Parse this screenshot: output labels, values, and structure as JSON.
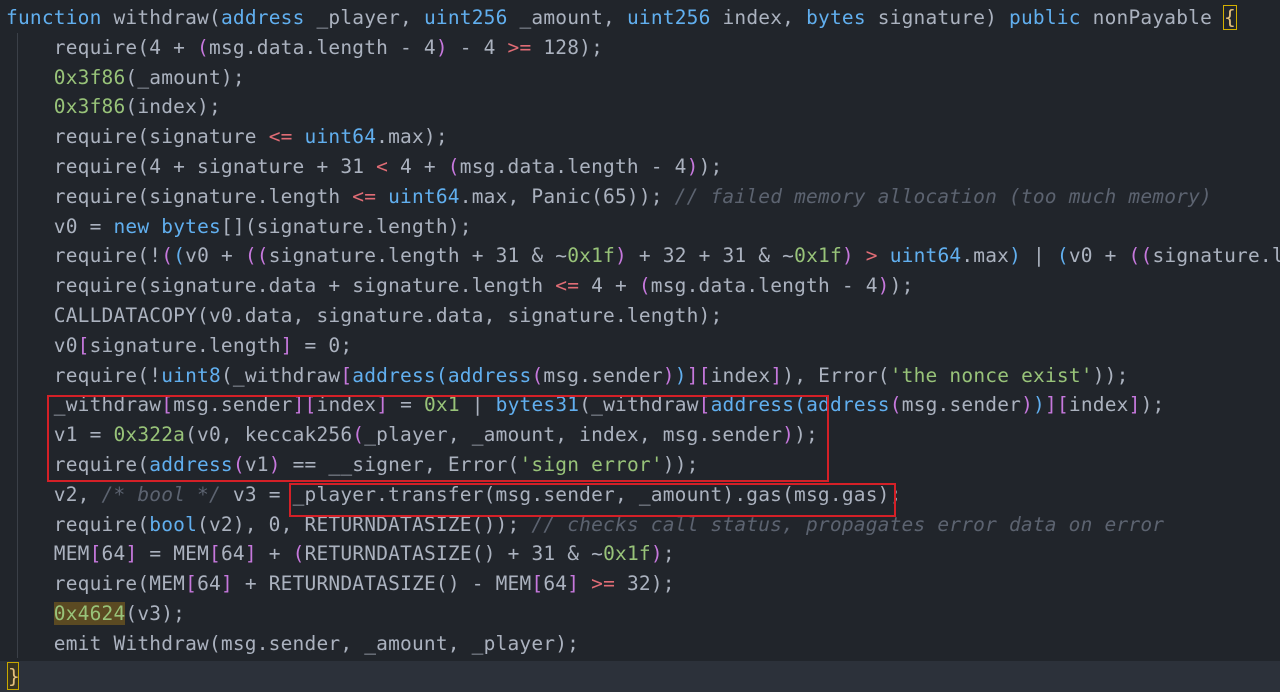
{
  "code": {
    "lines": [
      [
        [
          "t-kw",
          "function "
        ],
        [
          "t-pl",
          "withdraw("
        ],
        [
          "t-ty",
          "address"
        ],
        [
          "t-pl",
          " _player, "
        ],
        [
          "t-ty",
          "uint256"
        ],
        [
          "t-pl",
          " _amount, "
        ],
        [
          "t-ty",
          "uint256"
        ],
        [
          "t-pl",
          " index, "
        ],
        [
          "t-ty",
          "bytes"
        ],
        [
          "t-pl",
          " signature) "
        ],
        [
          "t-kw",
          "public"
        ],
        [
          "t-pl",
          " nonPayable "
        ],
        [
          "brace",
          "{"
        ]
      ],
      [
        [
          "t-pl",
          "    require(4 + "
        ],
        [
          "t-br1",
          "("
        ],
        [
          "t-pl",
          "msg.data.length - 4"
        ],
        [
          "t-br1",
          ")"
        ],
        [
          "t-pl",
          " - 4 "
        ],
        [
          "t-op",
          ">="
        ],
        [
          "t-pl",
          " 128);"
        ]
      ],
      [
        [
          "t-pl",
          "    "
        ],
        [
          "t-num",
          "0x3f86"
        ],
        [
          "t-pl",
          "(_amount);"
        ]
      ],
      [
        [
          "t-pl",
          "    "
        ],
        [
          "t-num",
          "0x3f86"
        ],
        [
          "t-pl",
          "(index);"
        ]
      ],
      [
        [
          "t-pl",
          "    require(signature "
        ],
        [
          "t-op",
          "<="
        ],
        [
          "t-pl",
          " "
        ],
        [
          "t-ty",
          "uint64"
        ],
        [
          "t-pl",
          ".max);"
        ]
      ],
      [
        [
          "t-pl",
          "    require(4 + signature + 31 "
        ],
        [
          "t-op",
          "<"
        ],
        [
          "t-pl",
          " 4 + "
        ],
        [
          "t-br1",
          "("
        ],
        [
          "t-pl",
          "msg.data.length - 4"
        ],
        [
          "t-br1",
          ")"
        ],
        [
          "t-pl",
          ");"
        ]
      ],
      [
        [
          "t-pl",
          "    require(signature.length "
        ],
        [
          "t-op",
          "<="
        ],
        [
          "t-pl",
          " "
        ],
        [
          "t-ty",
          "uint64"
        ],
        [
          "t-pl",
          ".max, Panic(65)); "
        ],
        [
          "t-cm",
          "// failed memory allocation (too much memory)"
        ]
      ],
      [
        [
          "t-pl",
          "    v0 = "
        ],
        [
          "t-kw",
          "new"
        ],
        [
          "t-pl",
          " "
        ],
        [
          "t-ty",
          "bytes"
        ],
        [
          "t-pl",
          "[](signature.length);"
        ]
      ],
      [
        [
          "t-pl",
          "    require(!"
        ],
        [
          "t-br1",
          "("
        ],
        [
          "t-br2",
          "("
        ],
        [
          "t-pl",
          "v0 + "
        ],
        [
          "t-br1",
          "(("
        ],
        [
          "t-pl",
          "signature.length + 31 & ~"
        ],
        [
          "t-num",
          "0x1f"
        ],
        [
          "t-br1",
          ")"
        ],
        [
          "t-pl",
          " + 32 + 31 & ~"
        ],
        [
          "t-num",
          "0x1f"
        ],
        [
          "t-br1",
          ")"
        ],
        [
          "t-pl",
          " "
        ],
        [
          "t-op",
          ">"
        ],
        [
          "t-pl",
          " "
        ],
        [
          "t-ty",
          "uint64"
        ],
        [
          "t-pl",
          ".max"
        ],
        [
          "t-br2",
          ")"
        ],
        [
          "t-pl",
          " | "
        ],
        [
          "t-br2",
          "("
        ],
        [
          "t-pl",
          "v0 + "
        ],
        [
          "t-br1",
          "(("
        ],
        [
          "t-pl",
          "signature.l"
        ]
      ],
      [
        [
          "t-pl",
          "    require(signature.data + signature.length "
        ],
        [
          "t-op",
          "<="
        ],
        [
          "t-pl",
          " 4 + "
        ],
        [
          "t-br1",
          "("
        ],
        [
          "t-pl",
          "msg.data.length - 4"
        ],
        [
          "t-br1",
          ")"
        ],
        [
          "t-pl",
          ");"
        ]
      ],
      [
        [
          "t-pl",
          "    CALLDATACOPY(v0.data, signature.data, signature.length);"
        ]
      ],
      [
        [
          "t-pl",
          "    v0"
        ],
        [
          "t-br1",
          "["
        ],
        [
          "t-pl",
          "signature.length"
        ],
        [
          "t-br1",
          "]"
        ],
        [
          "t-pl",
          " = 0;"
        ]
      ],
      [
        [
          "t-pl",
          "    require(!"
        ],
        [
          "t-ty",
          "uint8"
        ],
        [
          "t-pl",
          "(_withdraw"
        ],
        [
          "t-br1",
          "["
        ],
        [
          "t-ty",
          "address"
        ],
        [
          "t-br2",
          "("
        ],
        [
          "t-ty",
          "address"
        ],
        [
          "t-br1",
          "("
        ],
        [
          "t-pl",
          "msg.sender"
        ],
        [
          "t-br1",
          ")"
        ],
        [
          "t-br2",
          ")"
        ],
        [
          "t-br1",
          "]"
        ],
        [
          "t-br1",
          "["
        ],
        [
          "t-pl",
          "index"
        ],
        [
          "t-br1",
          "]"
        ],
        [
          "t-pl",
          "), Error("
        ],
        [
          "t-str",
          "'the nonce exist'"
        ],
        [
          "t-pl",
          "));"
        ]
      ],
      [
        [
          "t-pl",
          "    _withdraw"
        ],
        [
          "t-br1",
          "["
        ],
        [
          "t-pl",
          "msg.sender"
        ],
        [
          "t-br1",
          "]"
        ],
        [
          "t-br1",
          "["
        ],
        [
          "t-pl",
          "index"
        ],
        [
          "t-br1",
          "]"
        ],
        [
          "t-pl",
          " = "
        ],
        [
          "t-num",
          "0x1"
        ],
        [
          "t-pl",
          " | "
        ],
        [
          "t-ty",
          "bytes31"
        ],
        [
          "t-pl",
          "(_withdraw"
        ],
        [
          "t-br1",
          "["
        ],
        [
          "t-ty",
          "address"
        ],
        [
          "t-br2",
          "("
        ],
        [
          "t-ty",
          "address"
        ],
        [
          "t-br1",
          "("
        ],
        [
          "t-pl",
          "msg.sender"
        ],
        [
          "t-br1",
          ")"
        ],
        [
          "t-br2",
          ")"
        ],
        [
          "t-br1",
          "]"
        ],
        [
          "t-br1",
          "["
        ],
        [
          "t-pl",
          "index"
        ],
        [
          "t-br1",
          "]"
        ],
        [
          "t-pl",
          ");"
        ]
      ],
      [
        [
          "t-pl",
          "    v1 = "
        ],
        [
          "t-num",
          "0x322a"
        ],
        [
          "t-pl",
          "(v0, keccak256"
        ],
        [
          "t-br1",
          "("
        ],
        [
          "t-pl",
          "_player, _amount, index, msg.sender"
        ],
        [
          "t-br1",
          ")"
        ],
        [
          "t-pl",
          ");"
        ]
      ],
      [
        [
          "t-pl",
          "    require("
        ],
        [
          "t-ty",
          "address"
        ],
        [
          "t-br1",
          "("
        ],
        [
          "t-pl",
          "v1"
        ],
        [
          "t-br1",
          ")"
        ],
        [
          "t-pl",
          " == __signer, Error("
        ],
        [
          "t-str",
          "'sign error'"
        ],
        [
          "t-pl",
          "));"
        ]
      ],
      [
        [
          "t-pl",
          "    v2, "
        ],
        [
          "t-cm",
          "/* bool */"
        ],
        [
          "t-pl",
          " v3 = _player.transfer(msg.sender, _amount).gas(msg.gas);"
        ]
      ],
      [
        [
          "t-pl",
          "    require("
        ],
        [
          "t-ty",
          "bool"
        ],
        [
          "t-pl",
          "(v2), 0, RETURNDATASIZE()); "
        ],
        [
          "t-cm",
          "// checks call status, propagates error data on error"
        ]
      ],
      [
        [
          "t-pl",
          "    MEM"
        ],
        [
          "t-br1",
          "["
        ],
        [
          "t-pl",
          "64"
        ],
        [
          "t-br1",
          "]"
        ],
        [
          "t-pl",
          " = MEM"
        ],
        [
          "t-br1",
          "["
        ],
        [
          "t-pl",
          "64"
        ],
        [
          "t-br1",
          "]"
        ],
        [
          "t-pl",
          " + "
        ],
        [
          "t-br1",
          "("
        ],
        [
          "t-pl",
          "RETURNDATASIZE() + 31 & ~"
        ],
        [
          "t-num",
          "0x1f"
        ],
        [
          "t-br1",
          ")"
        ],
        [
          "t-pl",
          ";"
        ]
      ],
      [
        [
          "t-pl",
          "    require(MEM"
        ],
        [
          "t-br1",
          "["
        ],
        [
          "t-pl",
          "64"
        ],
        [
          "t-br1",
          "]"
        ],
        [
          "t-pl",
          " + RETURNDATASIZE() - MEM"
        ],
        [
          "t-br1",
          "["
        ],
        [
          "t-pl",
          "64"
        ],
        [
          "t-br1",
          "]"
        ],
        [
          "t-pl",
          " "
        ],
        [
          "t-op",
          ">="
        ],
        [
          "t-pl",
          " 32);"
        ]
      ],
      [
        [
          "t-pl",
          "    "
        ],
        [
          "hl",
          "0x4624"
        ],
        [
          "t-pl",
          "(v3);"
        ]
      ],
      [
        [
          "t-pl",
          "    emit Withdraw(msg.sender, _amount, _player);"
        ]
      ]
    ],
    "closing_brace": "}"
  }
}
